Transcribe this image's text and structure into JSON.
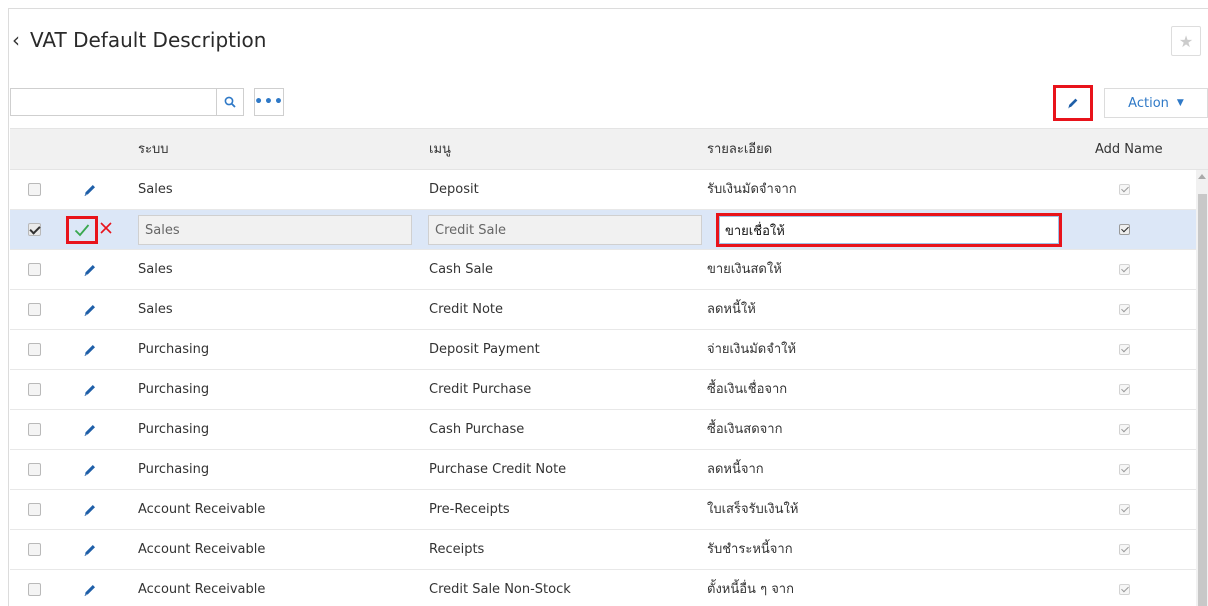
{
  "header": {
    "back_icon": "‹",
    "title": "VAT Default Description",
    "star_icon": "★"
  },
  "toolbar": {
    "search_placeholder": "",
    "more_label": "•••",
    "action_label": "Action",
    "action_caret": "▼"
  },
  "table": {
    "columns": [
      "ระบบ",
      "เมนู",
      "รายละเอียด",
      "Add Name"
    ],
    "rows": [
      {
        "system": "Sales",
        "menu": "Deposit",
        "detail": "รับเงินมัดจำจาก",
        "checked": false
      },
      {
        "system": "Sales",
        "menu": "Credit Sale",
        "detail": "ขายเชื่อให้",
        "checked": true
      },
      {
        "system": "Sales",
        "menu": "Cash Sale",
        "detail": "ขายเงินสดให้",
        "checked": false
      },
      {
        "system": "Sales",
        "menu": "Credit Note",
        "detail": "ลดหนี้ให้",
        "checked": false
      },
      {
        "system": "Purchasing",
        "menu": "Deposit Payment",
        "detail": "จ่ายเงินมัดจำให้",
        "checked": false
      },
      {
        "system": "Purchasing",
        "menu": "Credit Purchase",
        "detail": "ซื้อเงินเชื่อจาก",
        "checked": false
      },
      {
        "system": "Purchasing",
        "menu": "Cash Purchase",
        "detail": "ซื้อเงินสดจาก",
        "checked": false
      },
      {
        "system": "Purchasing",
        "menu": "Purchase Credit Note",
        "detail": "ลดหนี้จาก",
        "checked": false
      },
      {
        "system": "Account Receivable",
        "menu": "Pre-Receipts",
        "detail": "ใบเสร็จรับเงินให้",
        "checked": false
      },
      {
        "system": "Account Receivable",
        "menu": "Receipts",
        "detail": "รับชำระหนี้จาก",
        "checked": false
      },
      {
        "system": "Account Receivable",
        "menu": "Credit Sale Non-Stock",
        "detail": "ตั้งหนี้อื่น ๆ จาก",
        "checked": false
      }
    ],
    "editing_row_index": 1
  },
  "colors": {
    "accent": "#2f79c7",
    "highlight_box": "#e8131b",
    "selected_row": "#dce7f7",
    "confirm_check": "#3aa84f"
  },
  "icons": [
    "back-chevron-icon",
    "star-icon",
    "search-icon",
    "more-icon",
    "pencil-icon",
    "check-icon",
    "close-icon",
    "caret-down-icon"
  ]
}
